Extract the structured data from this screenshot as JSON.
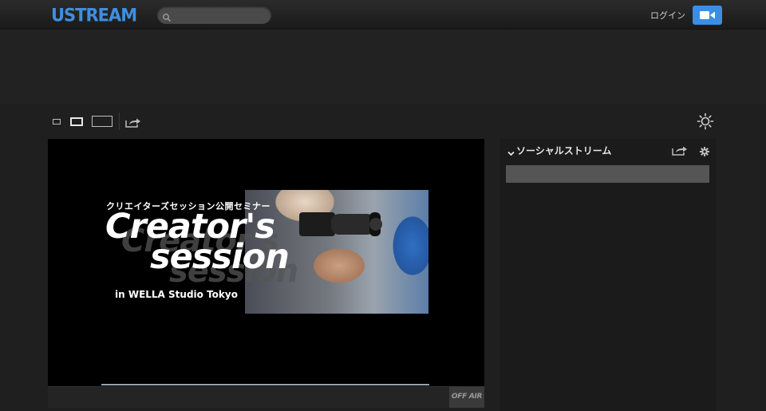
{
  "header": {
    "logo": "USTREAM",
    "search": {
      "placeholder": "",
      "value": ""
    },
    "login_label": "ログイン",
    "broadcast_icon": "video-camera-icon"
  },
  "toolbar": {
    "size_options": [
      "small",
      "medium",
      "large"
    ],
    "selected_size": "medium",
    "share_icon": "share-icon",
    "theme_icon": "brightness-icon"
  },
  "player": {
    "promo": {
      "jp_title": "クリエイターズセッション公開セミナー",
      "title_line1": "Creator's",
      "title_line2": "session",
      "location": "in  WELLA  Studio Tokyo"
    },
    "status_label": "OFF AIR"
  },
  "social": {
    "title": "ソーシャルストリーム",
    "input": {
      "placeholder": "",
      "value": ""
    }
  },
  "colors": {
    "accent": "#3a8ee6",
    "logo": "#3f8fe0",
    "background": "#1f1f1f"
  }
}
